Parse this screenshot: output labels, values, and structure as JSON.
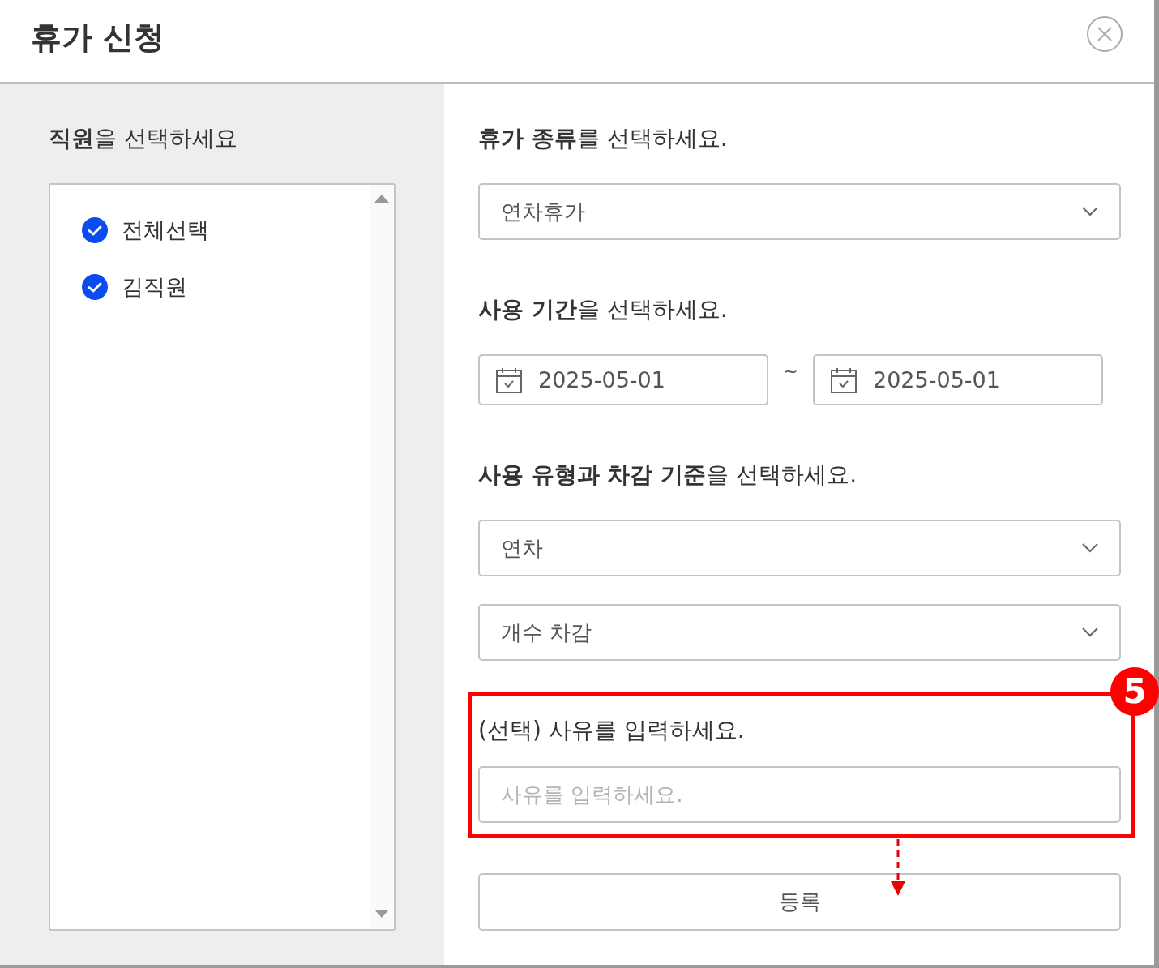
{
  "dialog": {
    "title": "휴가 신청"
  },
  "employee_panel": {
    "heading": "**직원**을 선택하세요",
    "items": [
      {
        "label": "전체선택",
        "checked": true
      },
      {
        "label": "김직원",
        "checked": true
      }
    ]
  },
  "form": {
    "sections": [
      {
        "kind": "select",
        "heading": "**휴가 종류**를 선택하세요.",
        "selects": [
          {
            "value": "연차휴가"
          }
        ]
      },
      {
        "kind": "date_range",
        "heading": "**사용 기간**을 선택하세요.",
        "start": "2025-05-01",
        "separator": "~",
        "end": "2025-05-01"
      },
      {
        "kind": "select",
        "heading": "**사용 유형과 차감 기준**을 선택하세요.",
        "selects": [
          {
            "value": "연차"
          },
          {
            "value": "개수 차감"
          }
        ]
      },
      {
        "kind": "text",
        "heading": "(선택) 사유를 입력하세요.",
        "placeholder": "사유를 입력하세요.",
        "highlighted": true,
        "badge": "5"
      }
    ],
    "submit": "등록"
  }
}
